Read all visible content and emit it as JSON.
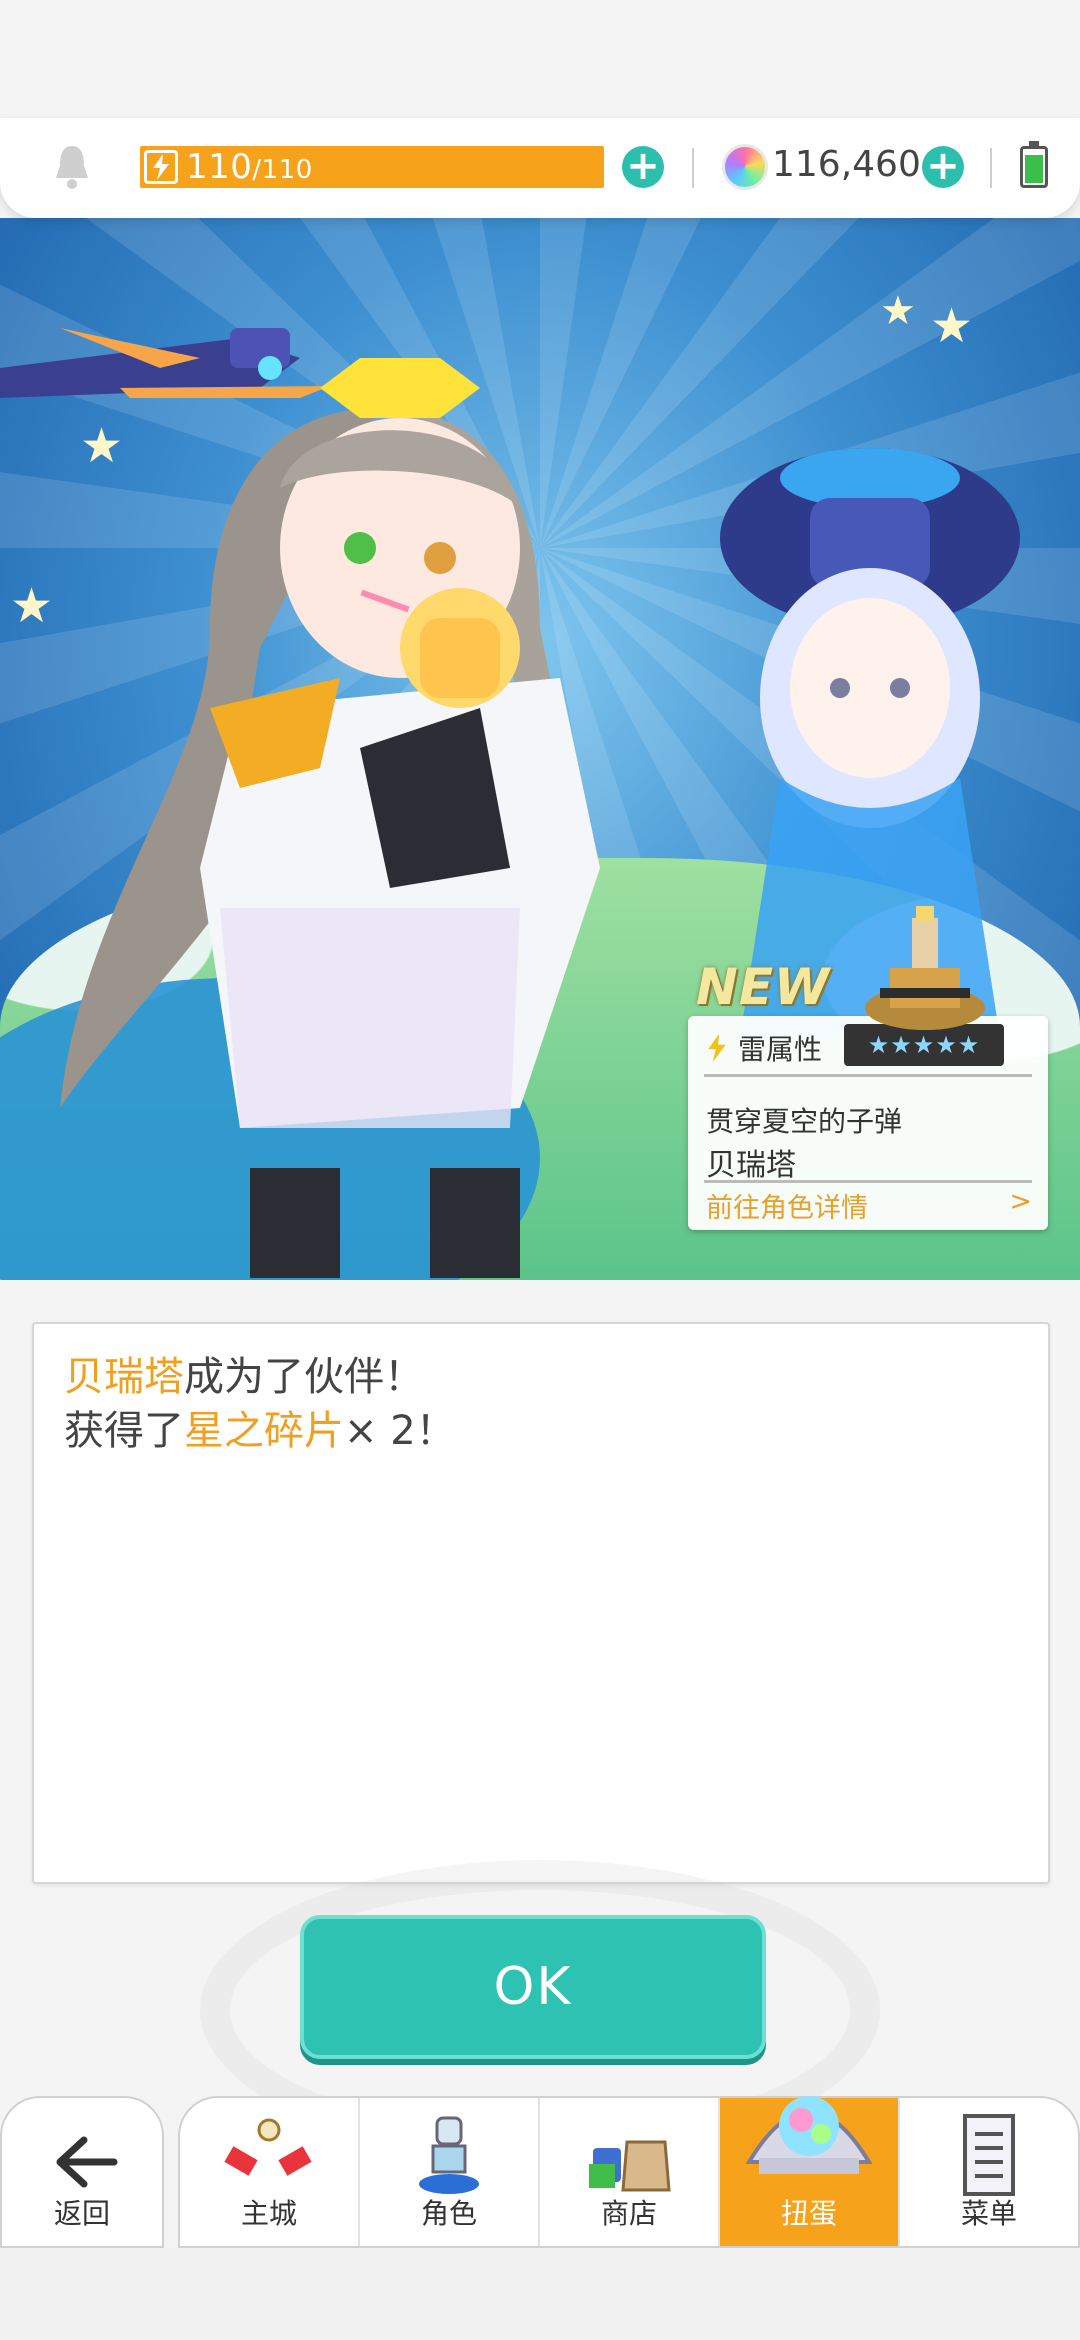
{
  "status_bar": {
    "stamina_value": "110",
    "stamina_max": "/110",
    "gems": "116,460",
    "stamina_plus_icon": "plus-icon",
    "gem_plus_icon": "plus-icon"
  },
  "hero": {
    "new_badge": "NEW",
    "card": {
      "attribute": "雷属性",
      "title": "贯穿夏空的子弹",
      "name": "贝瑞塔",
      "link": "前往角色详情",
      "chevron": ">",
      "stars": "★★★★★"
    }
  },
  "message": {
    "line1_highlight": "贝瑞塔",
    "line1_rest": "成为了伙伴！",
    "line2_prefix": "获得了",
    "line2_highlight": "星之碎片",
    "line2_suffix": "× 2！"
  },
  "ok_button": {
    "label": "OK"
  },
  "nav": {
    "back": "返回",
    "items": [
      {
        "label": "主城",
        "icon": "city-icon"
      },
      {
        "label": "角色",
        "icon": "character-icon"
      },
      {
        "label": "商店",
        "icon": "shop-icon"
      },
      {
        "label": "扭蛋",
        "icon": "gacha-icon",
        "active": true
      },
      {
        "label": "菜单",
        "icon": "menu-icon"
      }
    ]
  },
  "colors": {
    "accent_orange": "#f7a21b",
    "accent_teal": "#2ec2b3",
    "highlight_text": "#f0a020"
  }
}
